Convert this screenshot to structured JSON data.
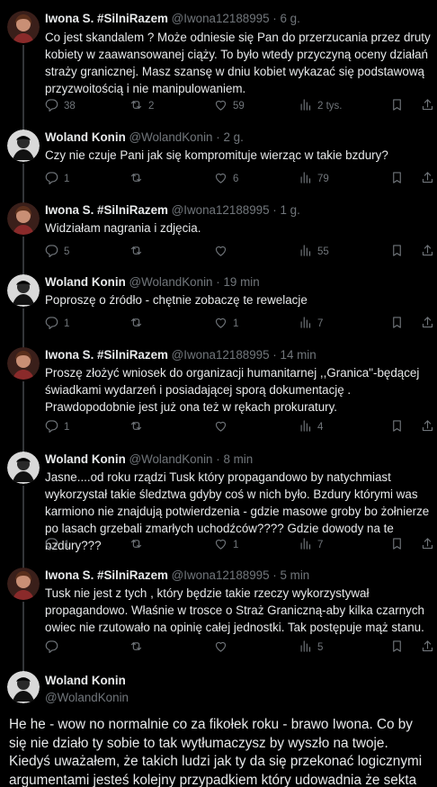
{
  "tweets": [
    {
      "name": "Iwona S. #SilniRazem",
      "handle": "@Iwona12188995",
      "time": "6 g.",
      "text": "Co jest skandalem ? Może odniesie się Pan do przerzucania przez druty kobiety w zaawansowanej ciąży. To było wtedy przyczyną oceny działań straży granicznej. Masz szansę w dniu kobiet wykazać się podstawową przyzwoitością i nie manipulowaniem.",
      "replies": "38",
      "reposts": "2",
      "likes": "59",
      "views": "2 tys."
    },
    {
      "name": "Woland Konin",
      "handle": "@WolandKonin",
      "time": "2 g.",
      "text": "Czy nie czuje Pani jak się kompromituje wierząc w takie bzdury?",
      "replies": "1",
      "reposts": "",
      "likes": "6",
      "views": "79"
    },
    {
      "name": "Iwona S. #SilniRazem",
      "handle": "@Iwona12188995",
      "time": "1 g.",
      "text": "Widziałam nagrania i zdjęcia.",
      "replies": "5",
      "reposts": "",
      "likes": "",
      "views": "55"
    },
    {
      "name": "Woland Konin",
      "handle": "@WolandKonin",
      "time": "19 min",
      "text": "Poproszę o źródło - chętnie zobaczę te rewelacje",
      "replies": "1",
      "reposts": "",
      "likes": "1",
      "views": "7"
    },
    {
      "name": "Iwona S. #SilniRazem",
      "handle": "@Iwona12188995",
      "time": "14 min",
      "text": "Proszę złożyć wniosek do organizacji humanitarnej ,,Granica\"-będącej świadkami wydarzeń i posiadającej sporą dokumentację . Prawdopodobnie jest już ona też w rękach prokuratury.",
      "replies": "1",
      "reposts": "",
      "likes": "",
      "views": "4"
    },
    {
      "name": "Woland Konin",
      "handle": "@WolandKonin",
      "time": "8 min",
      "text": "Jasne....od roku rządzi Tusk który propagandowo by natychmiast wykorzystał takie śledztwa gdyby coś w nich było. Bzdury którymi was karmiono nie znajdują potwierdzenia - gdzie masowe groby bo żołnierze po lasach grzebali zmarłych uchodźców???? Gdzie dowody na te bzdury???",
      "replies": "1",
      "reposts": "",
      "likes": "1",
      "views": "7"
    },
    {
      "name": "Iwona S. #SilniRazem",
      "handle": "@Iwona12188995",
      "time": "5 min",
      "text": "Tusk nie jest z tych , który będzie takie rzeczy wykorzystywał propagandowo. Właśnie w trosce o Straż Graniczną-aby kilka czarnych owiec nie rzutowało na opinię całej jednostki. Tak postępuje mąż stanu.",
      "replies": "",
      "reposts": "",
      "likes": "",
      "views": "5"
    }
  ],
  "focus": {
    "name": "Woland Konin",
    "handle": "@WolandKonin",
    "text": "He he - wow no normalnie co za fikołek roku - brawo Iwona. Co by się nie działo ty sobie to tak wytłumaczysz by wyszło na twoje. Kiedyś uważałem, że takich ludzi jak ty da się przekonać logicznymi argumentami jesteś kolejny przypadkiem który udowadnia że sekta"
  },
  "colors": {
    "background": "#000000",
    "text": "#e7e9ea",
    "muted": "#71767b",
    "thread_line": "#333639"
  },
  "icons": [
    "reply-icon",
    "repost-icon",
    "like-icon",
    "views-icon",
    "bookmark-icon",
    "share-icon"
  ]
}
